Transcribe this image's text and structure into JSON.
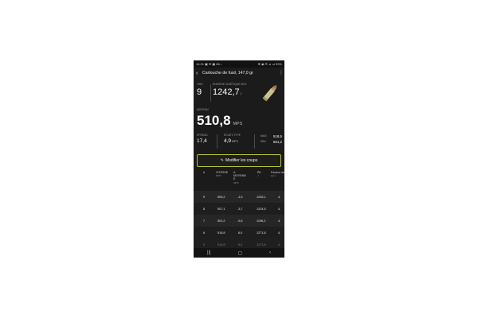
{
  "statusbar": {
    "time": "16:31",
    "left_icons": "▣ ✉ ▣ 86 •",
    "right_icons": "✻ ◉ ✆ ⊿ ⊿",
    "battery": "53%"
  },
  "appbar": {
    "title": "Cartouche de fusil, 147,0 gr"
  },
  "stats": {
    "tirs_label": "TIRS",
    "tirs_value": "9",
    "energy_label": "ÉNERGIE CINÉTIQUE MOY.",
    "energy_value": "1242,7",
    "energy_unit": "J",
    "moyen_label": "MOYENN",
    "moyen_value": "510,8",
    "moyen_unit": "MPS",
    "spread_label": "SPREAD",
    "spread_value": "17,4",
    "ecart_label": "ÉCART-TYPE",
    "ecart_value": "4,9",
    "ecart_unit": "MPS",
    "max_label": "MAX",
    "max_value": "518,5",
    "min_label": "MIN",
    "min_value": "501,2"
  },
  "modify_button": {
    "label": "Modifier les coups"
  },
  "table": {
    "headers": [
      {
        "text": "#",
        "sub": ""
      },
      {
        "text": "VITESSE",
        "sub": "MPS"
      },
      {
        "text": "Δ MOYENN E",
        "sub": "MPS"
      },
      {
        "text": "ÉK",
        "sub": "J"
      },
      {
        "text": "Facteur de puissance",
        "sub": "kgf·s"
      }
    ],
    "rows": [
      [
        "9",
        "509,2",
        "-1,5",
        "1235,1",
        "4,"
      ],
      [
        "8",
        "507,1",
        "-3,7",
        "1224,5",
        "4,"
      ],
      [
        "7",
        "501,2",
        "-9,6",
        "1196,2",
        "4,"
      ],
      [
        "6",
        "516,8",
        "6,0",
        "1271,8",
        "4,"
      ],
      [
        "5",
        "516,8",
        "6,0",
        "1271,8",
        "4,"
      ]
    ]
  },
  "navbar": {
    "recent": "|||",
    "home": "▢",
    "back": "‹"
  },
  "colors": {
    "accent": "#b9c23a",
    "background": "#1b1b1b"
  },
  "icons": {
    "bullet": "bullet-cartridge-icon"
  }
}
